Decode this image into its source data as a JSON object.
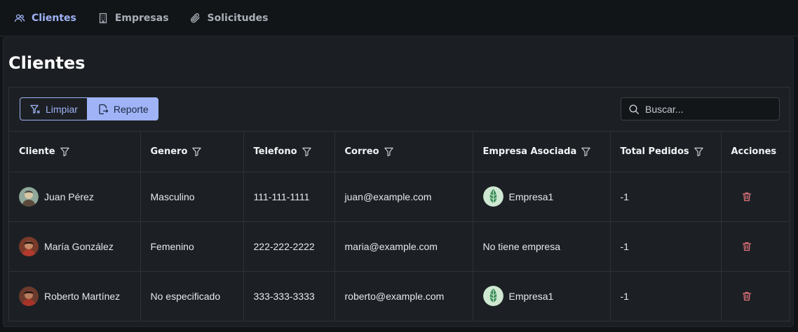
{
  "nav": {
    "items": [
      {
        "label": "Clientes",
        "icon": "users-icon",
        "active": true
      },
      {
        "label": "Empresas",
        "icon": "building-icon",
        "active": false
      },
      {
        "label": "Solicitudes",
        "icon": "paperclip-icon",
        "active": false
      }
    ]
  },
  "page": {
    "title": "Clientes"
  },
  "toolbar": {
    "clear_label": "Limpiar",
    "report_label": "Reporte",
    "search_placeholder": "Buscar..."
  },
  "table": {
    "columns": [
      "Cliente",
      "Genero",
      "Telefono",
      "Correo",
      "Empresa Asociada",
      "Total Pedidos",
      "Acciones"
    ],
    "rows": [
      {
        "cliente": "Juan Pérez",
        "genero": "Masculino",
        "telefono": "111-111-1111",
        "correo": "juan@example.com",
        "empresa": "Empresa1",
        "has_logo": true,
        "total": "-1"
      },
      {
        "cliente": "María González",
        "genero": "Femenino",
        "telefono": "222-222-2222",
        "correo": "maria@example.com",
        "empresa": "No tiene empresa",
        "has_logo": false,
        "total": "-1"
      },
      {
        "cliente": "Roberto Martínez",
        "genero": "No especificado",
        "telefono": "333-333-3333",
        "correo": "roberto@example.com",
        "empresa": "Empresa1",
        "has_logo": true,
        "total": "-1"
      }
    ]
  },
  "colors": {
    "accent": "#9fb3f6",
    "danger": "#e0737a",
    "background": "#111417",
    "panel": "#1b1f23"
  }
}
